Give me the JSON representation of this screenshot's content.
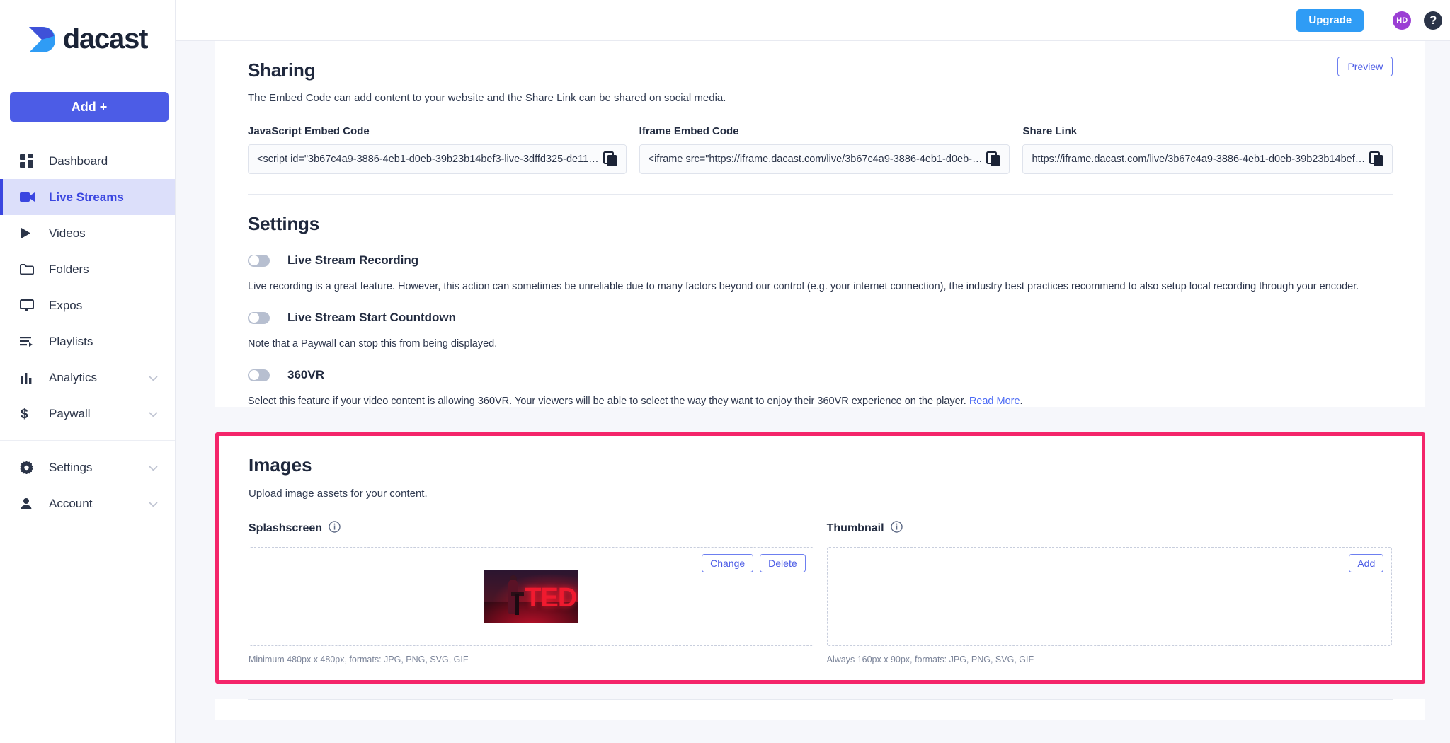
{
  "brand": {
    "name": "dacast",
    "logo_icon": "dacast-chevron-logo"
  },
  "sidebar": {
    "add_button": "Add +",
    "items": [
      {
        "label": "Dashboard",
        "icon": "dashboard-grid-icon",
        "active": false,
        "chevron": false
      },
      {
        "label": "Live Streams",
        "icon": "video-camera-icon",
        "active": true,
        "chevron": false
      },
      {
        "label": "Videos",
        "icon": "play-triangle-icon",
        "active": false,
        "chevron": false
      },
      {
        "label": "Folders",
        "icon": "folder-icon",
        "active": false,
        "chevron": false
      },
      {
        "label": "Expos",
        "icon": "monitor-icon",
        "active": false,
        "chevron": false
      },
      {
        "label": "Playlists",
        "icon": "playlist-icon",
        "active": false,
        "chevron": false
      },
      {
        "label": "Analytics",
        "icon": "bar-chart-icon",
        "active": false,
        "chevron": true
      },
      {
        "label": "Paywall",
        "icon": "dollar-sign-icon",
        "active": false,
        "chevron": true
      },
      {
        "label": "Settings",
        "icon": "gear-icon",
        "active": false,
        "chevron": true
      },
      {
        "label": "Account",
        "icon": "person-icon",
        "active": false,
        "chevron": true
      }
    ]
  },
  "topbar": {
    "upgrade_label": "Upgrade",
    "avatar_initials": "HD",
    "help_icon": "question-mark-icon"
  },
  "sharing": {
    "title": "Sharing",
    "description": "The Embed Code can add content to your website and the Share Link can be shared on social media.",
    "preview_label": "Preview",
    "fields": [
      {
        "label": "JavaScript Embed Code",
        "value": "<script id=\"3b67c4a9-3886-4eb1-d0eb-39b23b14bef3-live-3dffd325-de11…",
        "copy_icon": "copy-icon"
      },
      {
        "label": "Iframe Embed Code",
        "value": "<iframe src=\"https://iframe.dacast.com/live/3b67c4a9-3886-4eb1-d0eb-…",
        "copy_icon": "copy-icon"
      },
      {
        "label": "Share Link",
        "value": "https://iframe.dacast.com/live/3b67c4a9-3886-4eb1-d0eb-39b23b14bef…",
        "copy_icon": "copy-icon"
      }
    ]
  },
  "settings": {
    "title": "Settings",
    "toggles": [
      {
        "label": "Live Stream Recording",
        "state": "off",
        "description": "Live recording is a great feature. However, this action can sometimes be unreliable due to many factors beyond our control (e.g. your internet connection), the industry best practices recommend to also setup local recording through your encoder."
      },
      {
        "label": "Live Stream Start Countdown",
        "state": "off",
        "description": "Note that a Paywall can stop this from being displayed."
      },
      {
        "label": "360VR",
        "state": "off",
        "description": "Select this feature if your video content is allowing 360VR. Your viewers will be able to select the way they want to enjoy their 360VR experience on the player. ",
        "link_text": "Read More",
        "link_suffix": "."
      }
    ]
  },
  "images": {
    "title": "Images",
    "description": "Upload image assets for your content.",
    "highlight_color": "#f4256a",
    "columns": [
      {
        "label": "Splashscreen",
        "info_icon": "info-circle-icon",
        "has_image": true,
        "image_alt": "TED talk speaker on stage with red TED letters",
        "image_text": "TED",
        "buttons": [
          "Change",
          "Delete"
        ],
        "note": "Minimum 480px x 480px, formats: JPG, PNG, SVG, GIF"
      },
      {
        "label": "Thumbnail",
        "info_icon": "info-circle-icon",
        "has_image": false,
        "buttons": [
          "Add"
        ],
        "note": "Always 160px x 90px, formats: JPG, PNG, SVG, GIF"
      }
    ]
  },
  "colors": {
    "primary": "#4c5ce6",
    "upgrade": "#2f9cf5",
    "avatar": "#9b3fd4",
    "highlight": "#f4256a",
    "link": "#4c6bf5"
  }
}
